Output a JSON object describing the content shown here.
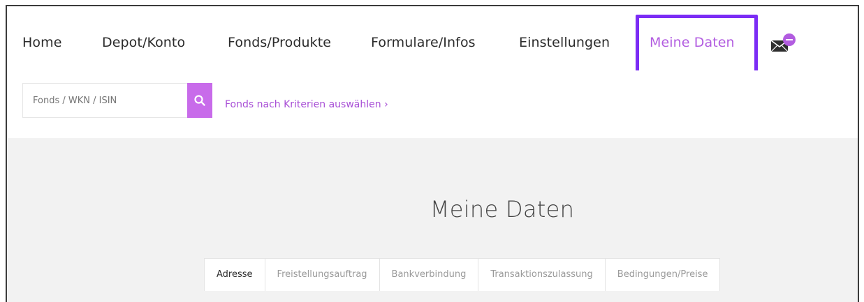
{
  "nav": {
    "items": [
      {
        "label": "Home"
      },
      {
        "label": "Depot/Konto"
      },
      {
        "label": "Fonds/Produkte"
      },
      {
        "label": "Formulare/Infos"
      },
      {
        "label": "Einstellungen"
      },
      {
        "label": "Meine Daten",
        "active": true
      }
    ],
    "mail_icon": "envelope-with-badge-icon"
  },
  "search": {
    "placeholder": "Fonds / WKN / ISIN",
    "button_icon": "search-icon",
    "criteria_link": "Fonds nach Kriterien auswählen ›"
  },
  "main": {
    "title": "Meine Daten",
    "tabs": [
      {
        "label": "Adresse",
        "active": true
      },
      {
        "label": "Freistellungsauftrag"
      },
      {
        "label": "Bankverbindung"
      },
      {
        "label": "Transaktionszulassung"
      },
      {
        "label": "Bedingungen/Preise"
      }
    ]
  },
  "colors": {
    "accent": "#b25ce0",
    "highlight": "#7b2cf5",
    "search_button": "#c86bea"
  }
}
